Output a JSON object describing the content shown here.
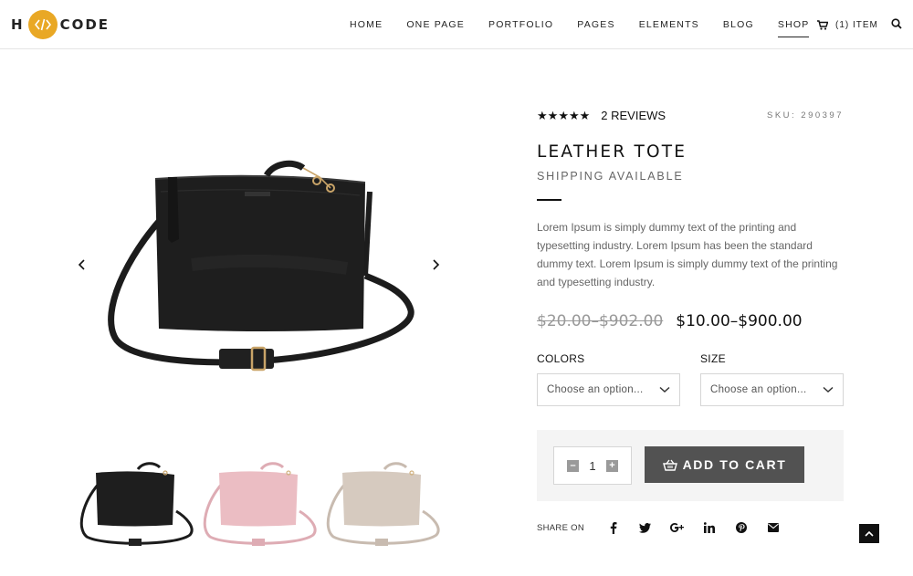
{
  "brand": {
    "left": "H",
    "right": "CODE",
    "badge_icon": "code-icon",
    "badge_color": "#e9a825"
  },
  "nav": {
    "items": [
      {
        "label": "HOME"
      },
      {
        "label": "ONE PAGE"
      },
      {
        "label": "PORTFOLIO"
      },
      {
        "label": "PAGES"
      },
      {
        "label": "ELEMENTS"
      },
      {
        "label": "BLOG"
      },
      {
        "label": "SHOP",
        "active": true
      }
    ],
    "cart_label": "(1) ITEM",
    "cart_icon": "cart-icon",
    "search_icon": "search-icon"
  },
  "gallery": {
    "main_product_color": "#1a1a1a",
    "thumb_colors": [
      "#1a1a1a",
      "#e8b2b9",
      "#cfc1b5"
    ],
    "prev_icon": "chevron-left-icon",
    "next_icon": "chevron-right-icon"
  },
  "product": {
    "stars": 5,
    "reviews": "2 REVIEWS",
    "sku": "SKU: 290397",
    "title": "LEATHER TOTE",
    "subtitle": "SHIPPING AVAILABLE",
    "description": "Lorem Ipsum is simply dummy text of the printing and typesetting industry. Lorem Ipsum has been the standard dummy text. Lorem Ipsum is simply dummy text of the printing and typesetting industry.",
    "old_price": "$20.00–$902.00",
    "price": "$10.00–$900.00",
    "colors_label": "COLORS",
    "colors_placeholder": "Choose an option...",
    "size_label": "SIZE",
    "size_placeholder": "Choose an option...",
    "quantity": "1",
    "add_to_cart": "ADD TO CART",
    "button_color": "#525252"
  },
  "share": {
    "label": "SHARE ON",
    "icons": [
      "facebook-icon",
      "twitter-icon",
      "google-plus-icon",
      "linkedin-icon",
      "pinterest-icon",
      "email-icon"
    ]
  },
  "scroll_top_icon": "arrow-up-icon"
}
